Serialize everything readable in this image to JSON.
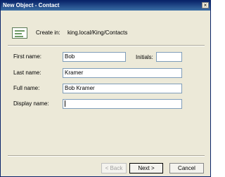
{
  "window": {
    "title": "New Object - Contact",
    "close_glyph": "×"
  },
  "header": {
    "icon": "contact-card-icon",
    "create_in_label": "Create in:",
    "create_in_path": "king.local/King/Contacts"
  },
  "form": {
    "first_name": {
      "label": "First name:",
      "value": "Bob"
    },
    "initials": {
      "label": "Initials:",
      "value": ""
    },
    "last_name": {
      "label": "Last name:",
      "value": "Kramer"
    },
    "full_name": {
      "label": "Full name:",
      "value": "Bob Kramer"
    },
    "display_name": {
      "label": "Display name:",
      "value": ""
    }
  },
  "buttons": {
    "back": {
      "label": "< Back",
      "enabled": false
    },
    "next": {
      "label": "Next >",
      "enabled": true
    },
    "cancel": {
      "label": "Cancel",
      "enabled": true
    }
  }
}
